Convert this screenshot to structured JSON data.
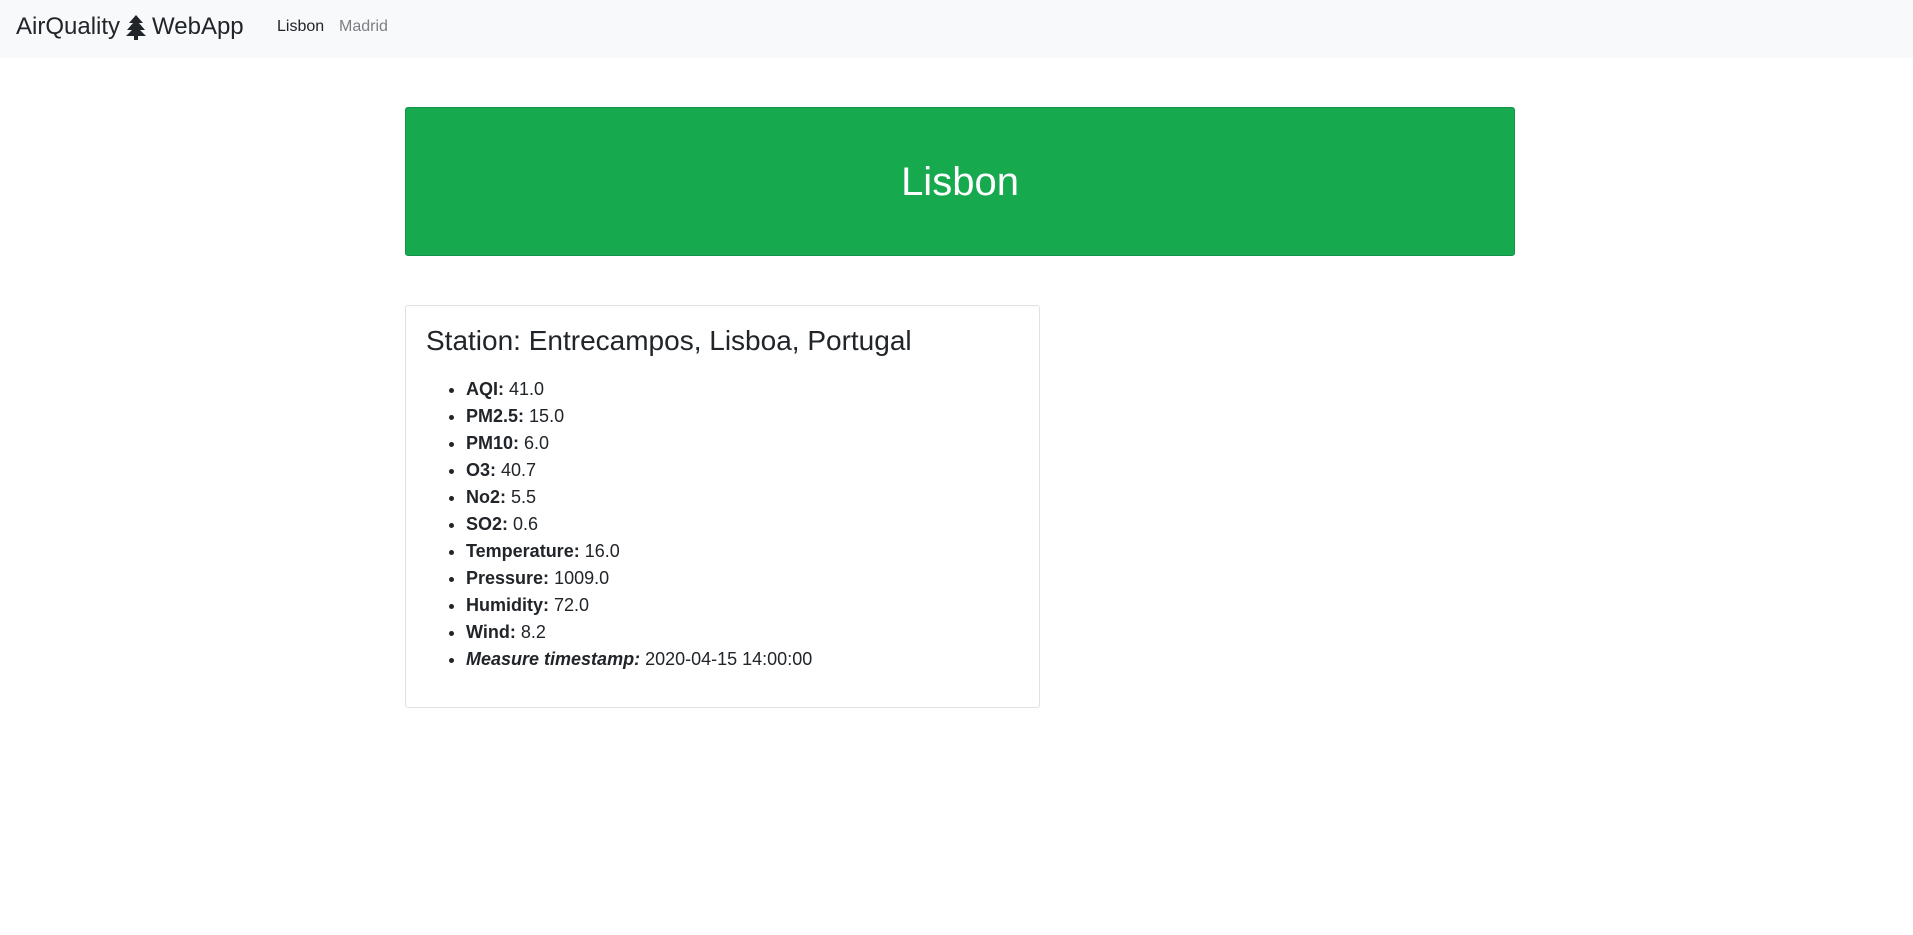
{
  "navbar": {
    "brand_left": "AirQuality",
    "brand_right": "WebApp",
    "brand_icon": "tree-icon",
    "links": [
      {
        "label": "Lisbon",
        "active": true
      },
      {
        "label": "Madrid",
        "active": false
      }
    ]
  },
  "banner": {
    "city": "Lisbon",
    "color": "#16a94e"
  },
  "station": {
    "title": "Station: Entrecampos, Lisboa, Portugal",
    "measures": [
      {
        "label": "AQI:",
        "value": "41.0"
      },
      {
        "label": "PM2.5:",
        "value": "15.0"
      },
      {
        "label": "PM10:",
        "value": "6.0"
      },
      {
        "label": "O3:",
        "value": "40.7"
      },
      {
        "label": "No2:",
        "value": "5.5"
      },
      {
        "label": "SO2:",
        "value": "0.6"
      },
      {
        "label": "Temperature:",
        "value": "16.0"
      },
      {
        "label": "Pressure:",
        "value": "1009.0"
      },
      {
        "label": "Humidity:",
        "value": "72.0"
      },
      {
        "label": "Wind:",
        "value": "8.2"
      },
      {
        "label": "Measure timestamp:",
        "value": "2020-04-15 14:00:00"
      }
    ]
  }
}
